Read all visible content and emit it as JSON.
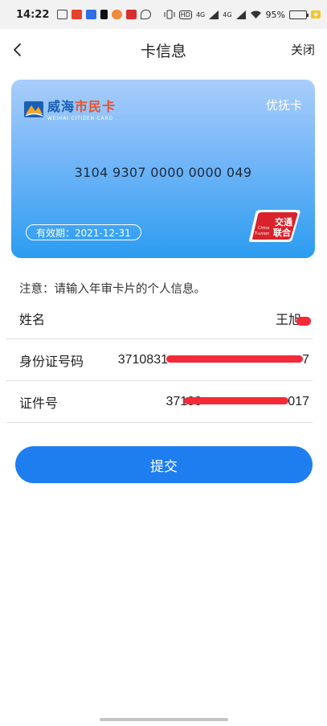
{
  "status_bar": {
    "time": "14:22",
    "battery": "95%",
    "network": [
      "HD",
      "4G",
      "4G"
    ],
    "battery_level": 0.95,
    "icons": [
      "notification-icons",
      "vibrate-icon",
      "signal-icon",
      "wifi-icon",
      "battery-icon",
      "charging-icon"
    ]
  },
  "nav": {
    "title": "卡信息",
    "close_label": "关闭",
    "back_icon": "chevron-left-icon"
  },
  "card": {
    "brand_cn_part1": "威海",
    "brand_cn_part2": "市民卡",
    "brand_en": "WEIHAI CITIZEN CARD",
    "type": "优抚卡",
    "number": "3104 9307 0000 0000 049",
    "validity": "有效期：2021-12-31",
    "tunion_cn": "交通联合",
    "tunion_en": "China T-union",
    "colors": {
      "top": "#a9cdfb",
      "bottom": "#2c9cf0",
      "tunion": "#d9222a"
    }
  },
  "form": {
    "notice": "注意：请输入年审卡片的个人信息。",
    "rows": [
      {
        "label": "姓名",
        "value": "王旭"
      },
      {
        "label": "身份证号码",
        "value": "3710831"
      },
      {
        "label": "证件号",
        "value": "37100"
      }
    ],
    "redacted_tail": [
      "7",
      "017"
    ]
  },
  "submit_label": "提交",
  "colors": {
    "accent": "#1e7ef0",
    "redaction": "#f52a38"
  }
}
